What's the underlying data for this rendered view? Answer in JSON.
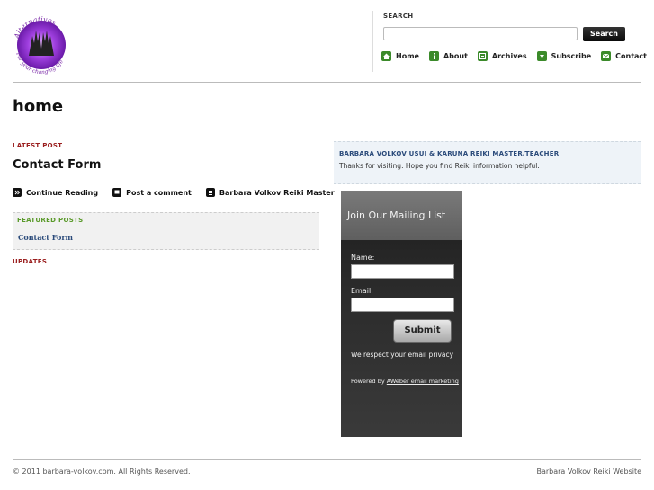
{
  "logo": {
    "text_top": "Alternatives",
    "text_bottom": "For your changing life"
  },
  "search": {
    "label": "SEARCH",
    "placeholder": "",
    "button": "Search"
  },
  "nav": [
    {
      "label": "Home",
      "icon": "home-icon"
    },
    {
      "label": "About",
      "icon": "info-icon"
    },
    {
      "label": "Archives",
      "icon": "archive-icon"
    },
    {
      "label": "Subscribe",
      "icon": "subscribe-icon"
    },
    {
      "label": "Contact",
      "icon": "mail-icon"
    }
  ],
  "page": {
    "title": "home"
  },
  "main": {
    "latest_label": "LATEST POST",
    "post_title": "Contact Form",
    "meta": [
      {
        "label": "Continue Reading",
        "icon": "continue-icon"
      },
      {
        "label": "Post a comment",
        "icon": "comment-icon"
      },
      {
        "label": "Barbara Volkov Reiki Master",
        "icon": "category-icon"
      }
    ],
    "featured_label": "FEATURED POSTS",
    "featured_link": "Contact Form",
    "updates_label": "UPDATES"
  },
  "sidebar": {
    "title": "BARBARA VOLKOV USUI & KARUNA REIKI MASTER/TEACHER",
    "text": "Thanks for visiting. Hope you find Reiki information helpful."
  },
  "mailing": {
    "title": "Join Our Mailing List",
    "name_label": "Name:",
    "email_label": "Email:",
    "submit": "Submit",
    "privacy": "We respect your email privacy",
    "powered_prefix": "Powered by",
    "powered_link": "AWeber email marketing"
  },
  "footer": {
    "left": "© 2011 barbara-volkov.com. All Rights Reserved.",
    "right": "Barbara Volkov Reiki Website"
  },
  "colors": {
    "nav_icon": "#3b8a2a",
    "section_red": "#9a1e1e",
    "featured_green": "#5a9a2a",
    "link_blue": "#2a4a7a"
  }
}
